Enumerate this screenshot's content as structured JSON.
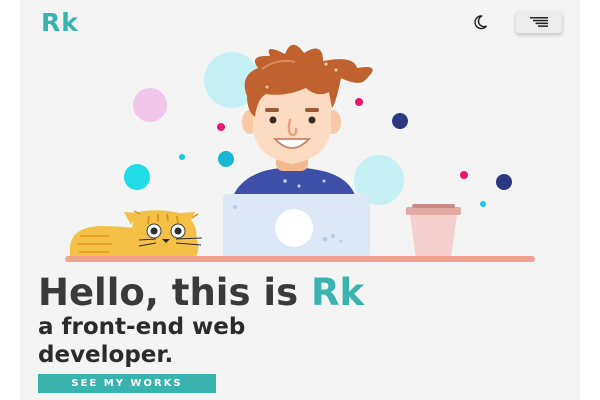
{
  "header": {
    "logo_text": "Rk",
    "theme_toggle_icon": "moon-icon",
    "menu_icon": "menu-icon"
  },
  "hero": {
    "title_prefix": "Hello, this is ",
    "title_name": "Rk",
    "subtitle": "a front-end web developer.",
    "cta_label": "SEE MY WORKS"
  },
  "colors": {
    "background": "#f4f4f4",
    "accent": "#39b3ae",
    "text": "#3a3a3a",
    "button_text": "#ffffff",
    "laptop": "#dce8f6",
    "table": "#f1a28f",
    "cat": "#f4c045",
    "hair": "#bf6230",
    "shirt": "#3d4fa7"
  },
  "illustration": {
    "scene": "developer-at-laptop",
    "icons": [
      "developer-icon",
      "laptop-icon",
      "cat-icon",
      "coffee-cup-icon",
      "decor-dot-icon"
    ]
  }
}
